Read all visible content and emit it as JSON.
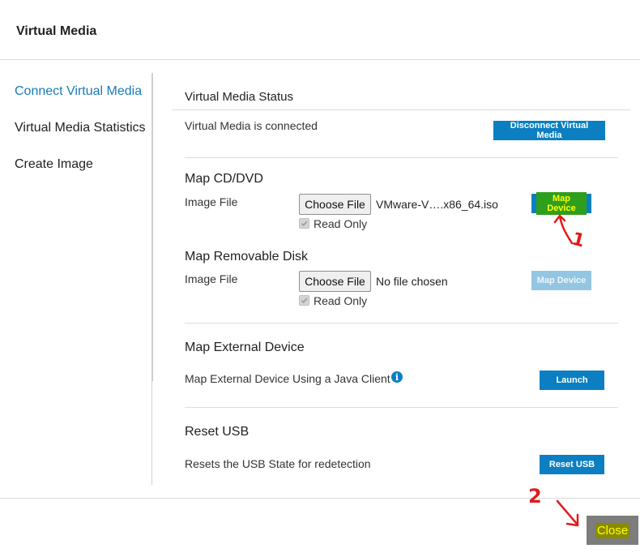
{
  "dialog": {
    "title": "Virtual Media"
  },
  "sidebar": {
    "items": [
      {
        "label": "Connect Virtual Media",
        "active": true
      },
      {
        "label": "Virtual Media Statistics",
        "active": false
      },
      {
        "label": "Create Image",
        "active": false
      }
    ]
  },
  "status": {
    "heading": "Virtual Media Status",
    "text": "Virtual Media is connected",
    "disconnect_label": "Disconnect Virtual Media"
  },
  "cd_dvd": {
    "heading": "Map CD/DVD",
    "image_file_label": "Image File",
    "choose_label": "Choose File",
    "file_name": "VMware-V….x86_64.iso",
    "read_only_label": "Read Only",
    "map_label": "Map Device"
  },
  "removable": {
    "heading": "Map Removable Disk",
    "image_file_label": "Image File",
    "choose_label": "Choose File",
    "file_name": "No file chosen",
    "read_only_label": "Read Only",
    "map_label": "Map Device"
  },
  "external": {
    "heading": "Map External Device",
    "text": "Map External Device Using a Java Client",
    "info_icon": "info-icon",
    "launch_label": "Launch"
  },
  "usb": {
    "heading": "Reset USB",
    "text": "Resets the USB State for redetection",
    "reset_label": "Reset USB"
  },
  "footer": {
    "close_label": "Close"
  },
  "annotations": {
    "first": "1",
    "second": "2"
  },
  "colors": {
    "accent": "#0b7fc2",
    "active_link": "#1a7bb5",
    "highlight_green": "#2e9e1d",
    "highlight_yellow": "#ffff00",
    "annotation_red": "#e01b1b"
  }
}
